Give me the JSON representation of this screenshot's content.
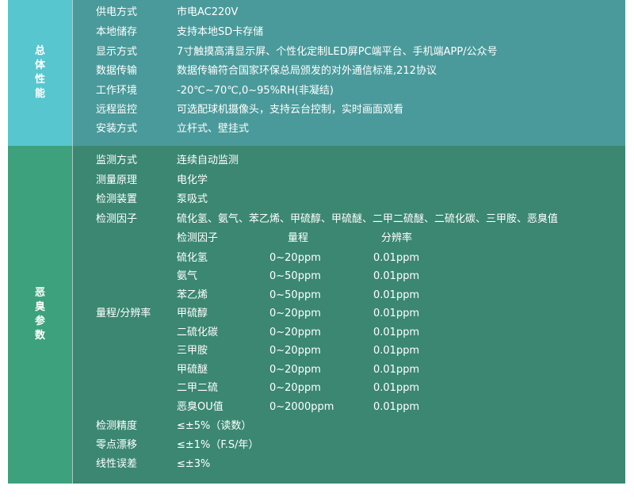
{
  "section1": {
    "title": "总体性能",
    "rows": [
      {
        "label": "供电方式",
        "value": "市电AC220V"
      },
      {
        "label": "本地储存",
        "value": "支持本地SD卡存储"
      },
      {
        "label": "显示方式",
        "value": "7寸触摸高清显示屏、个性化定制LED屏PC端平台、手机端APP/公众号"
      },
      {
        "label": "数据传输",
        "value": "数据传输符合国家环保总局颁发的对外通信标准,212协议"
      },
      {
        "label": "工作环境",
        "value": "-20℃~70℃,0~95%RH(非凝结)"
      },
      {
        "label": "远程监控",
        "value": "可选配球机摄像头，支持云台控制，实时画面观看"
      },
      {
        "label": "安装方式",
        "value": "立杆式、壁挂式"
      }
    ]
  },
  "section2": {
    "title": "恶臭参数",
    "rows_top": [
      {
        "label": "监测方式",
        "value": "连续自动监测"
      },
      {
        "label": "测量原理",
        "value": "电化学"
      },
      {
        "label": "检测装置",
        "value": "泵吸式"
      },
      {
        "label": "检测因子",
        "value": "硫化氢、氨气、苯乙烯、甲硫醇、甲硫醚、二甲二硫醚、二硫化碳、三甲胺、恶臭值"
      }
    ],
    "range_label": "量程/分辨率",
    "range_table": {
      "headers": [
        "检测因子",
        "量程",
        "分辨率"
      ],
      "rows": [
        [
          "硫化氢",
          "0~20ppm",
          "0.01ppm"
        ],
        [
          "氨气",
          "0~50ppm",
          "0.01ppm"
        ],
        [
          "苯乙烯",
          "0~50ppm",
          "0.01ppm"
        ],
        [
          "甲硫醇",
          "0~20ppm",
          "0.01ppm"
        ],
        [
          "二硫化碳",
          "0~20ppm",
          "0.01ppm"
        ],
        [
          "三甲胺",
          "0~20ppm",
          "0.01ppm"
        ],
        [
          "甲硫醚",
          "0~20ppm",
          "0.01ppm"
        ],
        [
          "二甲二硫",
          "0~20ppm",
          "0.01ppm"
        ],
        [
          "恶臭OU值",
          "0~2000ppm",
          "0.01ppm"
        ]
      ]
    },
    "rows_bottom": [
      {
        "label": "检测精度",
        "value": "≤±5%（读数）"
      },
      {
        "label": "零点漂移",
        "value": "≤±1%（F.S/年）"
      },
      {
        "label": "线性误差",
        "value": "≤±3%"
      }
    ]
  },
  "colors": {
    "section1_bg": "#4a9a9b",
    "section1_label_bg": "#57c6cf",
    "section2_bg": "#3b8771",
    "section2_label_bg": "#3da17e",
    "text": "#ffffff"
  }
}
